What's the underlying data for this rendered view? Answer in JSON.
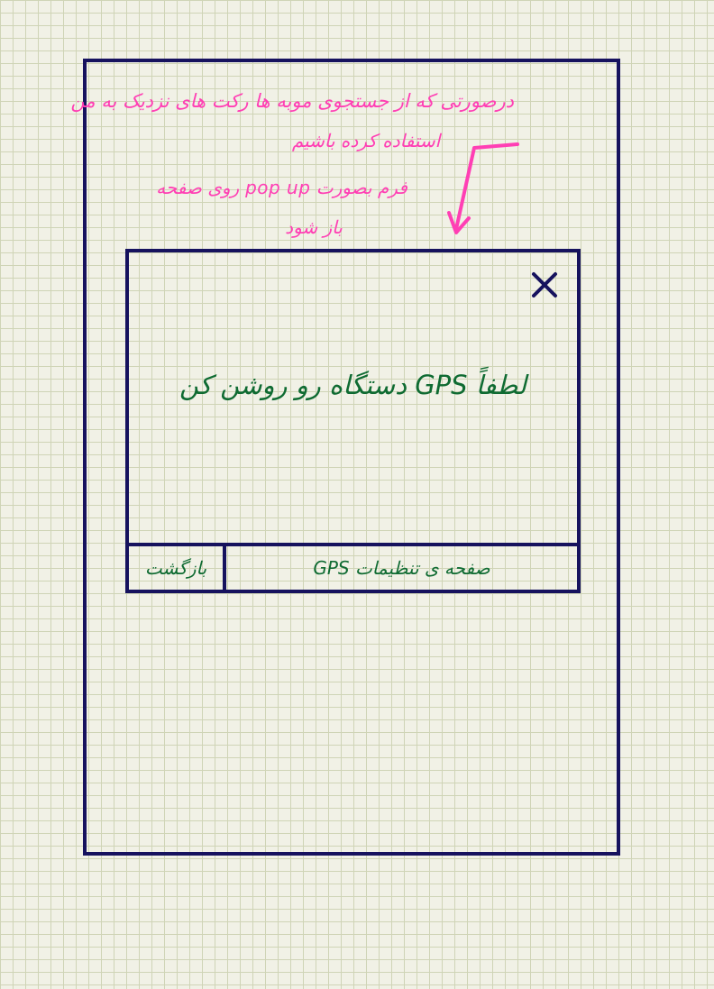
{
  "annotation": {
    "line1": "درصورتی که از جستجوی موبه ها رکت های نزدیک به من",
    "line2": "استفاده کرده باشیم",
    "line3": "فرم بصورت pop up روی صفحه",
    "line4": "باز شود"
  },
  "popup": {
    "close_icon": "close-icon",
    "message": "لطفاً GPS دستگاه رو روشن کن",
    "actions": {
      "settings_label": "صفحه ی تنظیمات GPS",
      "cancel_label": "بازگشت"
    }
  },
  "colors": {
    "frame": "#16125e",
    "annotation": "#ff3fb4",
    "text": "#0f6b32",
    "grid": "#cfd4b6",
    "background": "#f1f1e6"
  }
}
